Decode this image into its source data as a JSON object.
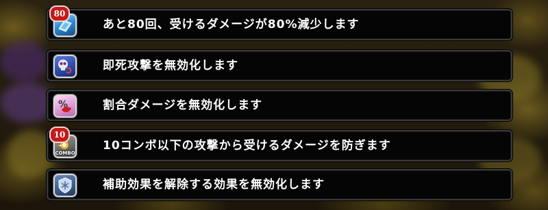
{
  "effects": [
    {
      "text": "あと80回、受けるダメージが80%減少します",
      "badge": "80",
      "icon": "shield-wall-icon",
      "color": "#2f8fd8"
    },
    {
      "text": "即死攻撃を無効化します",
      "badge": "",
      "icon": "skull-icon",
      "color": "#2b4aa8"
    },
    {
      "text": "割合ダメージを無効化します",
      "badge": "",
      "icon": "percent-icon",
      "color": "#e0a0d8"
    },
    {
      "text": "10コンボ以下の攻撃から受けるダメージを防ぎます",
      "badge": "10",
      "icon": "combo-icon",
      "color": "#6a6a6a",
      "icon_label": "COMBO"
    },
    {
      "text": "補助効果を解除する効果を無効化します",
      "badge": "",
      "icon": "shield-snowflake-icon",
      "color": "#3a5a8a"
    }
  ]
}
